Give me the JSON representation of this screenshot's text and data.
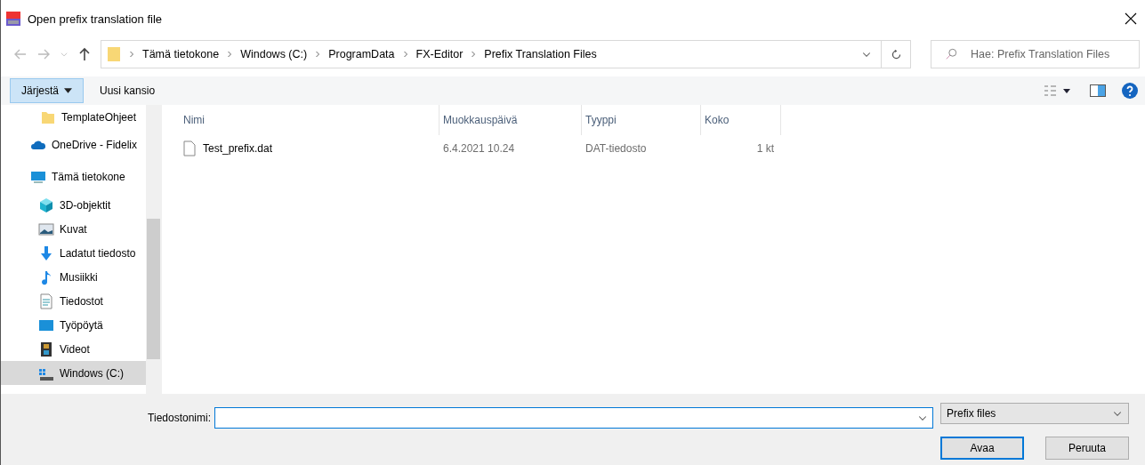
{
  "window": {
    "title": "Open prefix translation file"
  },
  "address_bar": {
    "path": [
      "Tämä tietokone",
      "Windows (C:)",
      "ProgramData",
      "FX-Editor",
      "Prefix Translation Files"
    ]
  },
  "search": {
    "placeholder": "Hae: Prefix Translation Files"
  },
  "toolbar": {
    "organize": "Järjestä",
    "new_folder": "Uusi kansio"
  },
  "sidebar": {
    "items": [
      {
        "label": "TemplateOhjeet",
        "kind": "folder",
        "selected": false,
        "nested": true
      },
      {
        "label": "OneDrive - Fidelix",
        "kind": "cloud",
        "selected": false
      },
      {
        "label": "Tämä tietokone",
        "kind": "computer",
        "selected": false,
        "children": [
          {
            "label": "3D-objektit",
            "kind": "cube",
            "selected": false
          },
          {
            "label": "Kuvat",
            "kind": "pictures",
            "selected": false
          },
          {
            "label": "Ladatut tiedosto",
            "kind": "download",
            "selected": false
          },
          {
            "label": "Musiikki",
            "kind": "music",
            "selected": false
          },
          {
            "label": "Tiedostot",
            "kind": "document",
            "selected": false
          },
          {
            "label": "Työpöytä",
            "kind": "desktop",
            "selected": false
          },
          {
            "label": "Videot",
            "kind": "video",
            "selected": false
          },
          {
            "label": "Windows (C:)",
            "kind": "drive",
            "selected": true
          }
        ]
      }
    ]
  },
  "table": {
    "columns": [
      "Nimi",
      "Muokkauspäivä",
      "Tyyppi",
      "Koko"
    ],
    "rows": [
      {
        "name": "Test_prefix.dat",
        "modified": "6.4.2021 10.24",
        "type": "DAT-tiedosto",
        "size": "1 kt",
        "selected": false
      }
    ]
  },
  "footer": {
    "filename_label": "Tiedostonimi:",
    "filter": "Prefix files",
    "buttons": [
      {
        "label": "Avaa",
        "kind": "primary"
      },
      {
        "label": "Peruuta",
        "kind": "secondary"
      }
    ]
  }
}
